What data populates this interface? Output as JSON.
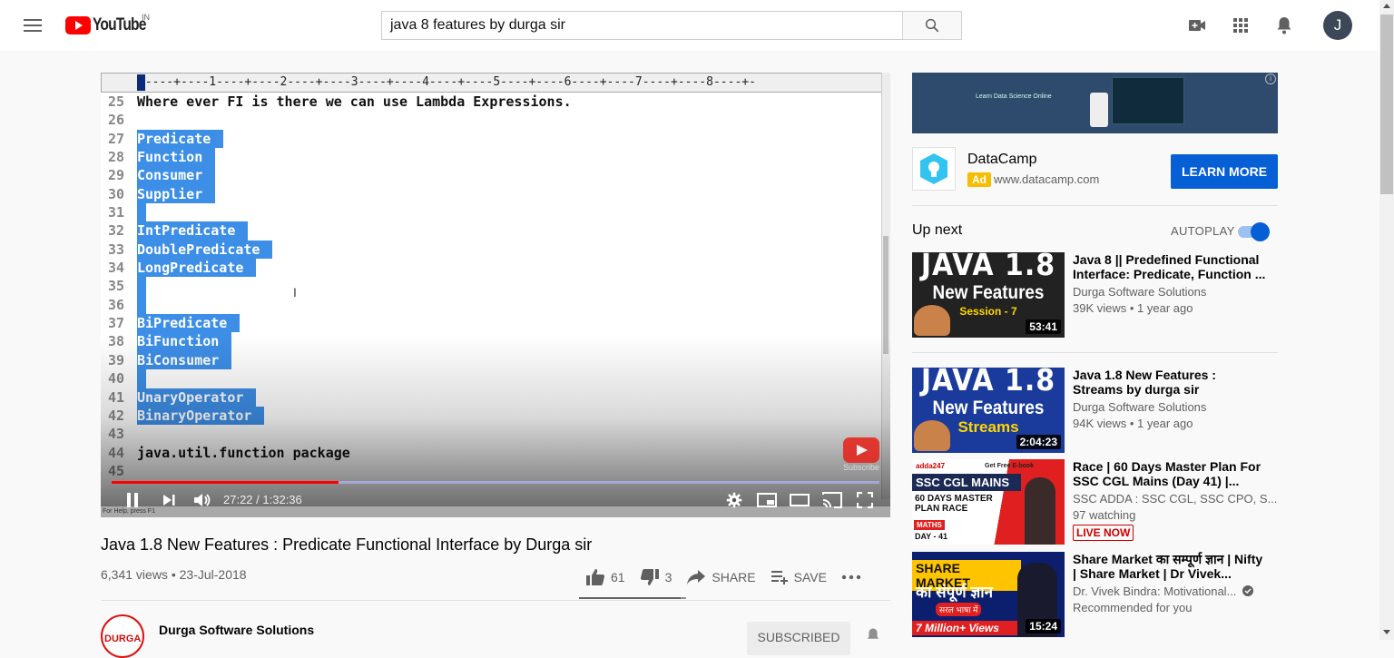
{
  "topbar": {
    "logo_text": "YouTube",
    "logo_region": "IN",
    "search_value": "java 8 features by durga sir",
    "avatar_letter": "J",
    "icons": [
      "menu-icon",
      "search-icon",
      "create-video-icon",
      "apps-icon",
      "notifications-icon"
    ]
  },
  "player": {
    "ruler": "+----+----1----+----2----+----3----+----4----+----5----+----6----+----7----+----8----+-",
    "lines": [
      {
        "n": "25",
        "text": "Where ever FI is there we can use Lambda Expressions.",
        "sel": false
      },
      {
        "n": "26",
        "text": "",
        "sel": false
      },
      {
        "n": "27",
        "text": "Predicate",
        "sel": true
      },
      {
        "n": "28",
        "text": "Function",
        "sel": true
      },
      {
        "n": "29",
        "text": "Consumer",
        "sel": true
      },
      {
        "n": "30",
        "text": "Supplier",
        "sel": true
      },
      {
        "n": "31",
        "text": "",
        "sel": true
      },
      {
        "n": "32",
        "text": "IntPredicate",
        "sel": true
      },
      {
        "n": "33",
        "text": "DoublePredicate",
        "sel": true
      },
      {
        "n": "34",
        "text": "LongPredicate",
        "sel": true
      },
      {
        "n": "35",
        "text": "",
        "sel": true
      },
      {
        "n": "36",
        "text": "",
        "sel": true
      },
      {
        "n": "37",
        "text": "BiPredicate",
        "sel": true
      },
      {
        "n": "38",
        "text": "BiFunction",
        "sel": true
      },
      {
        "n": "39",
        "text": "BiConsumer",
        "sel": true
      },
      {
        "n": "40",
        "text": "",
        "sel": true
      },
      {
        "n": "41",
        "text": "UnaryOperator",
        "sel": true
      },
      {
        "n": "42",
        "text": "BinaryOperator",
        "sel": true
      },
      {
        "n": "43",
        "text": "",
        "sel": false
      },
      {
        "n": "44",
        "text": "java.util.function package",
        "sel": false
      },
      {
        "n": "45",
        "text": "",
        "sel": false
      }
    ],
    "status_text": "For Help, press F1",
    "watermark_label": "Subscribe",
    "current_time": "27:22",
    "duration": "1:32:36",
    "progress_fraction": 0.295
  },
  "video": {
    "title": "Java 1.8 New Features : Predicate Functional Interface by Durga sir",
    "views": "6,341 views",
    "date": "23-Jul-2018",
    "likes": "61",
    "dislikes": "3",
    "share_label": "SHARE",
    "save_label": "SAVE",
    "like_fraction": 0.953
  },
  "channel": {
    "name": "Durga Software Solutions",
    "logo_text": "DURGA",
    "subscribe_label": "SUBSCRIBED"
  },
  "ad": {
    "banner_text": "Learn Data Science Online",
    "advertiser": "DataCamp",
    "badge": "Ad",
    "url": "www.datacamp.com",
    "cta": "LEARN MORE"
  },
  "upnext": {
    "heading": "Up next",
    "autoplay_label": "AUTOPLAY",
    "autoplay_on": true
  },
  "recommendations": [
    {
      "title": "Java 8 || Predefined Functional Interface: Predicate, Function ...",
      "channel": "Durga Software Solutions",
      "meta": "39K views • 1 year ago",
      "duration": "53:41",
      "thumb_line1": "JAVA 1.8",
      "thumb_line2": "New Features",
      "thumb_line3": "Session - 7",
      "thumb_color": "#222222"
    },
    {
      "title": "Java 1.8 New Features : Streams by durga sir",
      "channel": "Durga Software Solutions",
      "meta": "94K views • 1 year ago",
      "duration": "2:04:23",
      "thumb_line1": "JAVA 1.8",
      "thumb_line2": "New Features",
      "thumb_line3": "Streams",
      "thumb_color": "#1a3b9c"
    },
    {
      "title": "Race | 60 Days Master Plan For SSC CGL Mains (Day 41) |...",
      "channel": "SSC ADDA : SSC CGL, SSC CPO, S...",
      "meta": "97 watching",
      "live_label": "LIVE NOW",
      "thumb_line1": "SSC CGL MAINS",
      "thumb_line2": "60 DAYS MASTER PLAN RACE",
      "thumb_line3": "DAY - 41",
      "thumb_tag": "MATHS",
      "thumb_brand": "adda247",
      "thumb_ebook": "Get Free E-book"
    },
    {
      "title": "Share Market का सम्पूर्ण ज्ञान | Nifty | Share Market | Dr Vivek...",
      "channel": "Dr. Vivek Bindra: Motivational...",
      "meta": "Recommended for you",
      "duration": "15:24",
      "thumb_line1": "SHARE MARKET",
      "thumb_line2": "का संपूर्ण ज्ञान",
      "thumb_line3": "7 Million+ Views",
      "thumb_tag": "सरल भाषा में"
    }
  ]
}
